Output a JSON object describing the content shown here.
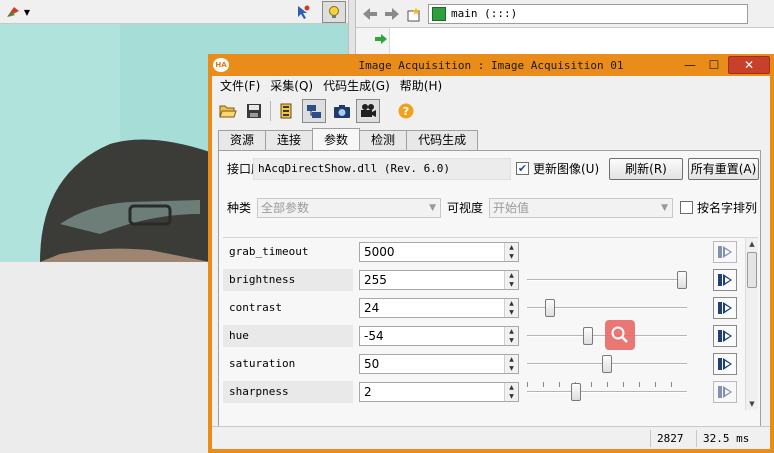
{
  "editor": {
    "procedure": "main (:::)"
  },
  "dialog": {
    "title": "Image Acquisition : Image Acquisition 01",
    "app_icon": "HA",
    "menu": [
      "文件(F)",
      "采集(Q)",
      "代码生成(G)",
      "帮助(H)"
    ],
    "tabs": [
      "资源",
      "连接",
      "参数",
      "检测",
      "代码生成"
    ],
    "active_tab": "参数",
    "interface_label": "接口库",
    "interface_value": "hAcqDirectShow.dll (Rev. 6.0)",
    "update_image_label": "更新图像(U)",
    "update_image_checked": true,
    "refresh_label": "刷新(R)",
    "reset_all_label": "所有重置(A)",
    "category_label": "种类",
    "category_value": "全部参数",
    "visibility_label": "可视度",
    "visibility_value": "开始值",
    "sort_label": "按名字排列",
    "sort_checked": false,
    "params": [
      {
        "name": "grab_timeout",
        "value": "5000"
      },
      {
        "name": "brightness",
        "value": "255",
        "slider": 1.0
      },
      {
        "name": "contrast",
        "value": "24",
        "slider": 0.12
      },
      {
        "name": "hue",
        "value": "-54",
        "slider": 0.37
      },
      {
        "name": "saturation",
        "value": "50",
        "slider": 0.5
      },
      {
        "name": "sharpness",
        "value": "2",
        "slider": 0.29
      }
    ],
    "status": {
      "count": "2827",
      "time": "32.5 ms"
    }
  }
}
